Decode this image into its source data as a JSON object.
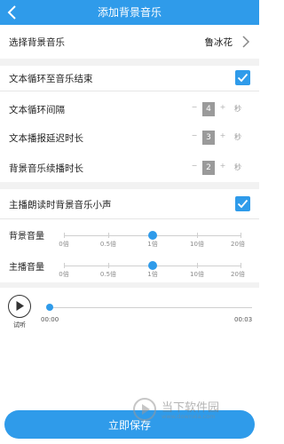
{
  "header": {
    "title": "添加背景音乐",
    "back_icon": "back-arrow-icon"
  },
  "music": {
    "label": "选择背景音乐",
    "value": "鲁冰花"
  },
  "loop": {
    "label": "文本循环至音乐结束",
    "checked": true
  },
  "interval": {
    "label": "文本循环间隔",
    "value": "4",
    "minus": "−",
    "plus": "+",
    "unit": "秒"
  },
  "delay": {
    "label": "文本播报延迟时长",
    "value": "3",
    "minus": "−",
    "plus": "+",
    "unit": "秒"
  },
  "continue": {
    "label": "背景音乐续播时长",
    "value": "2",
    "minus": "−",
    "plus": "+",
    "unit": "秒"
  },
  "duck": {
    "label": "主播朗读时背景音乐小声",
    "checked": true
  },
  "bg_volume": {
    "label": "背景音量",
    "ticks": [
      "0倍",
      "0.5倍",
      "1倍",
      "10倍",
      "20倍"
    ],
    "selected": "1倍"
  },
  "host_volume": {
    "label": "主播音量",
    "ticks": [
      "0倍",
      "0.5倍",
      "1倍",
      "10倍",
      "20倍"
    ],
    "selected": "1倍"
  },
  "preview": {
    "label": "试听",
    "start_time": "00:00",
    "end_time": "00:03",
    "progress": 0
  },
  "footer": {
    "save_label": "立即保存"
  },
  "watermark": {
    "text": "当下软件园",
    "url": "www.downxia.com"
  },
  "colors": {
    "accent": "#2f9bea",
    "background": "#ffffff",
    "gap": "#f2f2f2"
  }
}
